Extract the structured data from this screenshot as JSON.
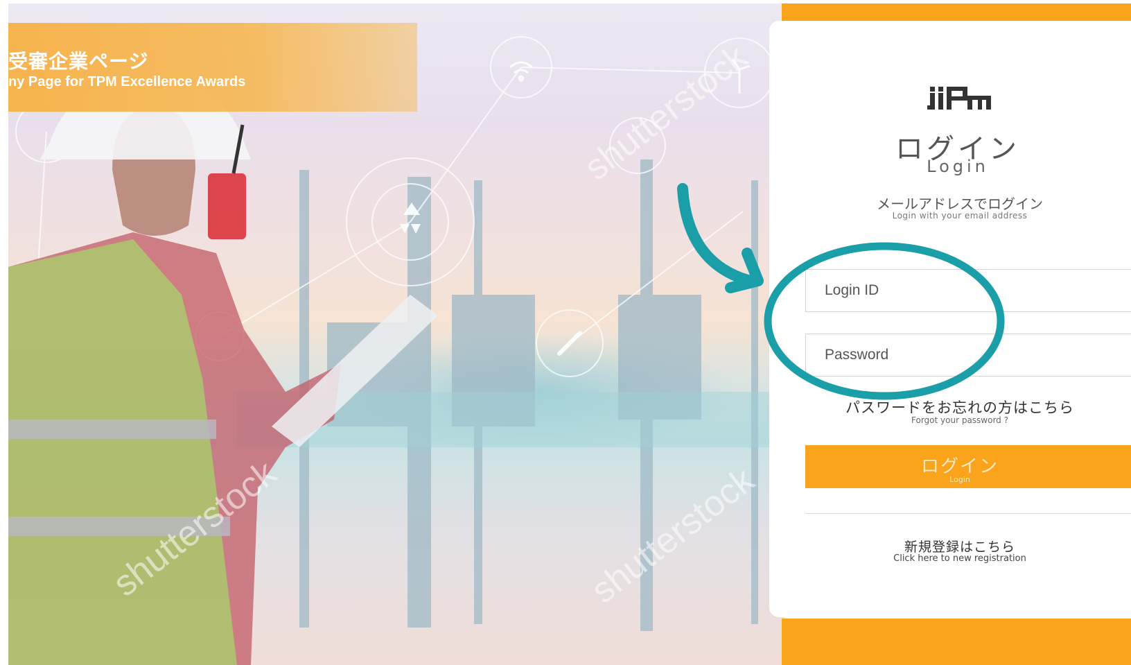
{
  "banner": {
    "title_jp": "受審企業ページ",
    "title_en": "ny Page for TPM Excellence Awards"
  },
  "watermark": {
    "text": "shutterstock"
  },
  "login_card": {
    "title_jp": "ログイン",
    "title_en": "Login",
    "subtitle_jp": "メールアドレスでログイン",
    "subtitle_en": "Login with your email address",
    "login_id_placeholder": "Login ID",
    "password_placeholder": "Password",
    "forgot_jp": "パスワードをお忘れの方はこちら",
    "forgot_en": "Forgot your password ?",
    "login_button_jp": "ログイン",
    "login_button_en": "Login",
    "register_jp": "新規登録はこちら",
    "register_en": "Click here to new registration"
  },
  "colors": {
    "accent_orange": "#f9a41a",
    "annotation_teal": "#1a9ea8"
  },
  "icons": [
    "jipm-logo-icon",
    "curved-arrow-icon",
    "highlight-ellipse-icon",
    "wifi-icon",
    "wind-turbine-icon",
    "recycle-icon",
    "wrench-icon"
  ]
}
